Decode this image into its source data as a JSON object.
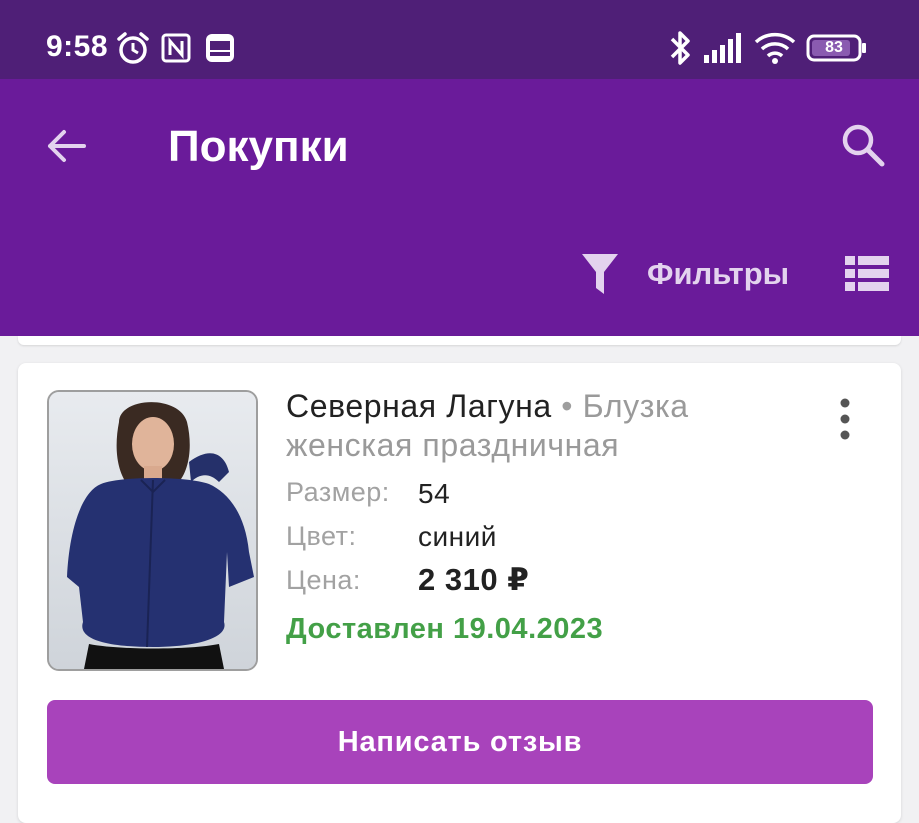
{
  "status_bar": {
    "time": "9:58",
    "battery": "83",
    "icons": [
      "alarm-icon",
      "nfc-icon",
      "ad-blocker-icon",
      "bluetooth-icon",
      "signal-icon",
      "wifi-icon",
      "battery-icon"
    ]
  },
  "app_bar": {
    "title": "Покупки",
    "filters_label": "Фильтры",
    "icons": [
      "back-arrow-icon",
      "search-icon",
      "filter-funnel-icon",
      "list-view-icon"
    ]
  },
  "purchase": {
    "brand": "Северная Лагуна",
    "separator": "•",
    "name": "Блузка женская праздничная",
    "attributes": [
      {
        "label": "Размер:",
        "value": "54"
      },
      {
        "label": "Цвет:",
        "value": "синий"
      },
      {
        "label": "Цена:",
        "value": "2 310 ₽"
      }
    ],
    "status": "Доставлен 19.04.2023",
    "review_button": "Написать отзыв"
  },
  "colors": {
    "status_bar_bg": "#4f1f77",
    "app_bar_bg": "#6a1b9a",
    "button_bg": "#a843bb",
    "delivered_green": "#43a047",
    "page_bg": "#f1f1f3"
  }
}
